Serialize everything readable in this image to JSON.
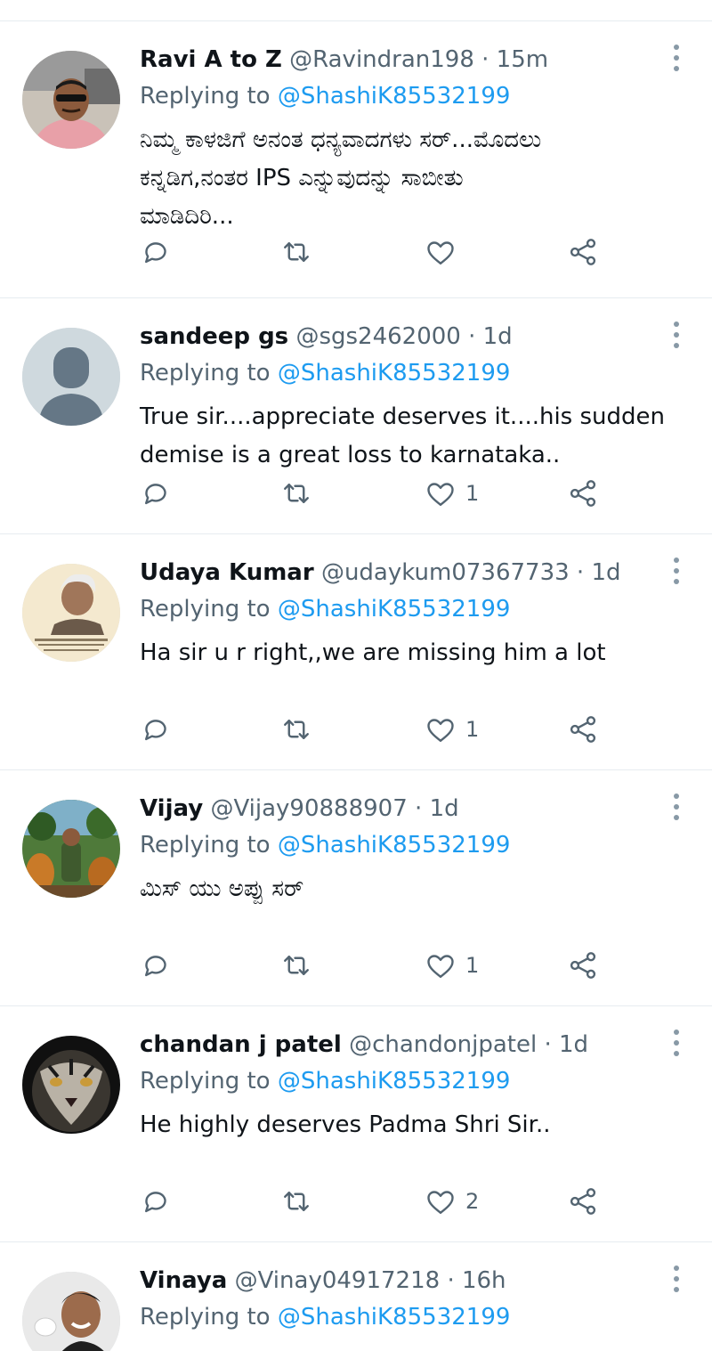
{
  "replying_label": "Replying to",
  "tweets": [
    {
      "name": "Ravi A to Z",
      "handle": "@Ravindran198",
      "time": "15m",
      "reply_to": "@ShashiK85532199",
      "lines": [
        "ನಿಮ್ಮ ಕಾಳಜಿಗೆ ಅನಂತ ಧನ್ಯವಾದಗಳು ಸರ್...ಮೊದಲು",
        "ಕನ್ನಡಿಗ,ನಂತರ IPS ಎನ್ನುವುದನ್ನು ಸಾಬೀತು",
        "ಮಾಡಿದಿರಿ..."
      ],
      "likes": ""
    },
    {
      "name": "sandeep gs",
      "handle": "@sgs2462000",
      "time": "1d",
      "reply_to": "@ShashiK85532199",
      "lines": [
        "True sir....appreciate deserves it....his sudden",
        "demise is a great loss to karnataka.."
      ],
      "likes": "1"
    },
    {
      "name": "Udaya Kumar",
      "handle": "@udaykum07367733",
      "time": "1d",
      "reply_to": "@ShashiK85532199",
      "lines": [
        "Ha sir u r right,,we are missing him a lot"
      ],
      "likes": "1"
    },
    {
      "name": "Vijay",
      "handle": "@Vijay90888907",
      "time": "1d",
      "reply_to": "@ShashiK85532199",
      "lines": [
        "ಮಿಸ್ ಯು ಅಪ್ಪು ಸರ್"
      ],
      "likes": "1"
    },
    {
      "name": "chandan j patel",
      "handle": "@chandonjpatel",
      "time": "1d",
      "reply_to": "@ShashiK85532199",
      "lines": [
        "He highly deserves Padma Shri Sir.."
      ],
      "likes": "2"
    },
    {
      "name": "Vinaya",
      "handle": "@Vinay04917218",
      "time": "16h",
      "reply_to": "@ShashiK85532199",
      "lines": [],
      "likes": ""
    }
  ],
  "colors": {
    "text": "#0f1419",
    "secondary": "#536471",
    "link": "#1d9bf0",
    "divider": "#e6ecf0",
    "icon": "#536471"
  },
  "icons": [
    "reply-icon",
    "retweet-icon",
    "like-icon",
    "share-icon",
    "more-icon"
  ]
}
